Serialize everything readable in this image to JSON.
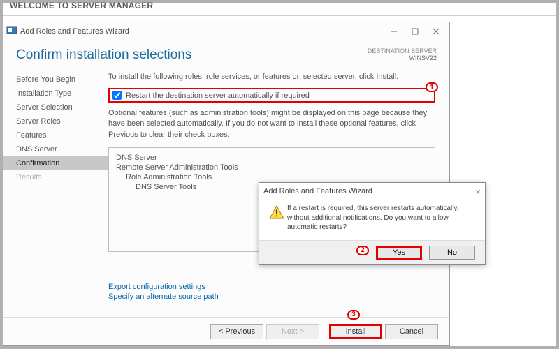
{
  "welcome": "WELCOME TO SERVER MANAGER",
  "window": {
    "title": "Add Roles and Features Wizard",
    "heading": "Confirm installation selections",
    "destLabel": "DESTINATION SERVER",
    "destValue": "WINSV22"
  },
  "sidebar": {
    "items": [
      {
        "label": "Before You Begin",
        "state": ""
      },
      {
        "label": "Installation Type",
        "state": ""
      },
      {
        "label": "Server Selection",
        "state": ""
      },
      {
        "label": "Server Roles",
        "state": ""
      },
      {
        "label": "Features",
        "state": ""
      },
      {
        "label": "DNS Server",
        "state": ""
      },
      {
        "label": "Confirmation",
        "state": "sel"
      },
      {
        "label": "Results",
        "state": "dis"
      }
    ]
  },
  "content": {
    "intro": "To install the following roles, role services, or features on selected server, click Install.",
    "checkbox_label": "Restart the destination server automatically if required",
    "checkbox_checked": true,
    "optional_text": "Optional features (such as administration tools) might be displayed on this page because they have been selected automatically. If you do not want to install these optional features, click Previous to clear their check boxes.",
    "features": [
      {
        "level": 0,
        "text": "DNS Server"
      },
      {
        "level": 0,
        "text": "Remote Server Administration Tools"
      },
      {
        "level": 1,
        "text": "Role Administration Tools"
      },
      {
        "level": 2,
        "text": "DNS Server Tools"
      }
    ],
    "links": {
      "export": "Export configuration settings",
      "altpath": "Specify an alternate source path"
    }
  },
  "buttons": {
    "previous": "< Previous",
    "next": "Next >",
    "install": "Install",
    "cancel": "Cancel"
  },
  "modal": {
    "title": "Add Roles and Features Wizard",
    "message": "If a restart is required, this server restarts automatically, without additional notifications. Do you want to allow automatic restarts?",
    "yes": "Yes",
    "no": "No"
  },
  "annotations": {
    "a1": "1",
    "a2": "2",
    "a3": "3"
  }
}
